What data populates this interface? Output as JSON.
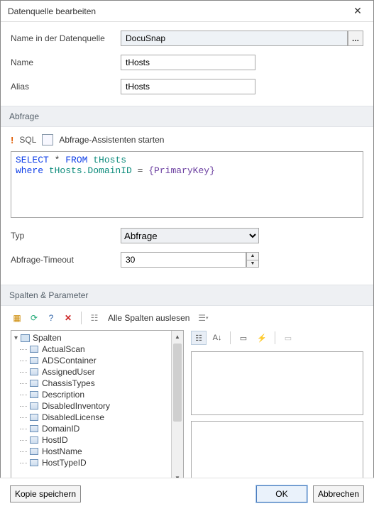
{
  "window": {
    "title": "Datenquelle bearbeiten"
  },
  "form": {
    "dsLabel": "Name in der Datenquelle",
    "dsValue": "DocuSnap",
    "moreBtn": "...",
    "nameLabel": "Name",
    "nameValue": "tHosts",
    "aliasLabel": "Alias",
    "aliasValue": "tHosts"
  },
  "querySection": {
    "title": "Abfrage",
    "sqlLabel": "SQL",
    "wizardText": "Abfrage-Assistenten starten",
    "sql": {
      "line1a": "SELECT",
      "line1b": " * ",
      "line1c": "FROM",
      "line1d": " tHosts",
      "line2a": "where",
      "line2b": " tHosts.DomainID ",
      "line2eq": "= ",
      "line2c": "{PrimaryKey}"
    },
    "typeLabel": "Typ",
    "typeValue": "Abfrage",
    "timeoutLabel": "Abfrage-Timeout",
    "timeoutValue": "30"
  },
  "columnsSection": {
    "title": "Spalten & Parameter",
    "readAll": "Alle Spalten auslesen",
    "rootLabel": "Spalten",
    "items": [
      "ActualScan",
      "ADSContainer",
      "AssignedUser",
      "ChassisTypes",
      "Description",
      "DisabledInventory",
      "DisabledLicense",
      "DomainID",
      "HostID",
      "HostName",
      "HostTypeID"
    ]
  },
  "footer": {
    "copy": "Kopie speichern",
    "ok": "OK",
    "cancel": "Abbrechen"
  }
}
